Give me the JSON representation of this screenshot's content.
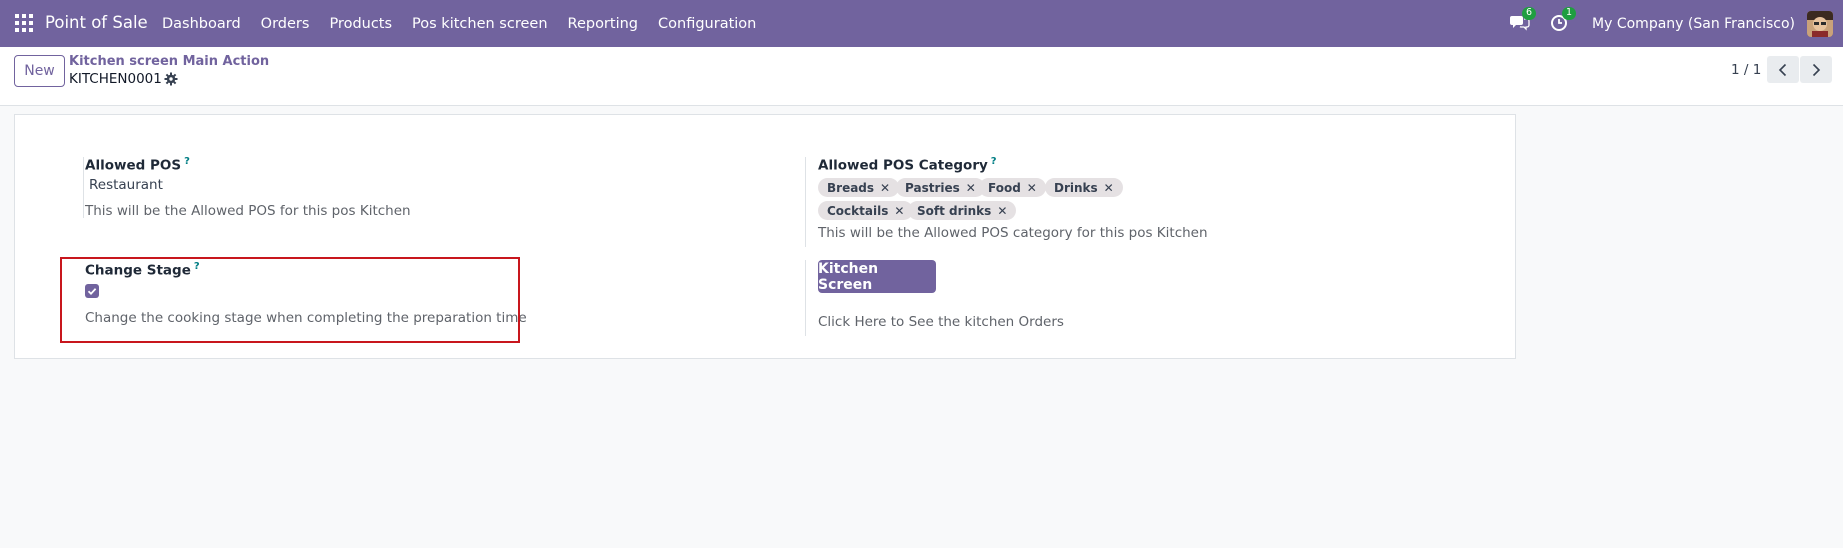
{
  "navbar": {
    "brand": "Point of Sale",
    "menu": [
      "Dashboard",
      "Orders",
      "Products",
      "Pos kitchen screen",
      "Reporting",
      "Configuration"
    ],
    "messages_count": "6",
    "activities_count": "1",
    "company": "My Company (San Francisco)"
  },
  "control_panel": {
    "new_label": "New",
    "breadcrumb": "Kitchen screen Main Action",
    "record_name": "KITCHEN0001",
    "pager": "1 / 1"
  },
  "form": {
    "allowed_pos": {
      "label": "Allowed POS",
      "help_mark": "?",
      "value": "Restaurant",
      "help": "This will be the Allowed POS for this pos Kitchen"
    },
    "allowed_pos_category": {
      "label": "Allowed POS Category",
      "help_mark": "?",
      "tags": [
        "Breads",
        "Pastries",
        "Food",
        "Drinks",
        "Cocktails",
        "Soft drinks"
      ],
      "help": "This will be the Allowed POS category for this pos Kitchen"
    },
    "change_stage": {
      "label": "Change Stage",
      "help_mark": "?",
      "checked": true,
      "help": "Change the cooking stage when completing the preparation time"
    },
    "kitchen_screen": {
      "button_label": "Kitchen Screen",
      "help": "Click Here to See the kitchen Orders"
    }
  },
  "colors": {
    "brand": "#71639e",
    "highlight": "#c8161d",
    "badge": "#1f9e40"
  }
}
